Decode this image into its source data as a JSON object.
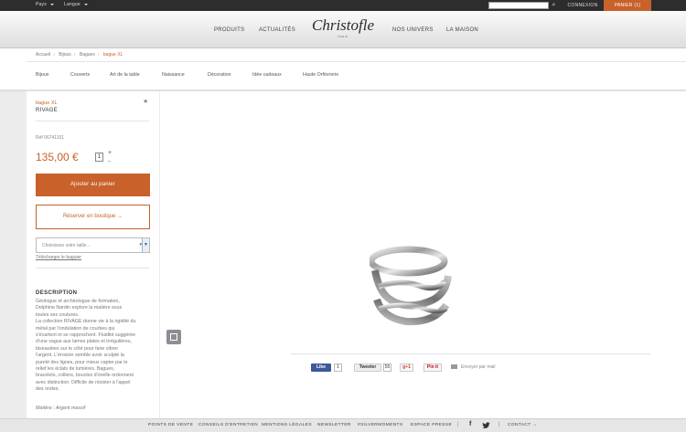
{
  "topbar": {
    "country_label": "Pays",
    "language_label": "Langue",
    "search_placeholder": "",
    "login_label": "CONNEXION",
    "cart_label": "PANIER (1)"
  },
  "header": {
    "nav": [
      "PRODUITS",
      "ACTUALITÉS",
      "NOS UNIVERS",
      "LA MAISON"
    ],
    "logo_text": "Christofle",
    "logo_sub": "PARIS"
  },
  "breadcrumb": [
    "Accueil",
    "Bijoux",
    "Bagues",
    "bague XL"
  ],
  "categories": [
    "Bijoux",
    "Couverts",
    "Art de la table",
    "Naissance",
    "Décoration",
    "Idée cadeaux",
    "Haute Orfèvrerie"
  ],
  "product": {
    "type": "bague XL",
    "name": "RIVAGE",
    "ref": "Réf 06741101",
    "price": "135,00 €",
    "quantity": "1",
    "add_to_cart": "Ajouter au panier",
    "reserve": "Réserver en boutique",
    "size_placeholder": "Choisissez votre taille...",
    "size_guide": "Télécharger le baguier",
    "description_title": "DESCRIPTION",
    "description": "Géologue et archéologue de formation, Delphine Nardin explore la matière sous toutes ses coutures.\nLa collection RIVAGE donne vie à la rigidité du métal par l'ondulation de courbes qui s'écartent et se rapprochent. Fluidité suggérée d'une vague aux lames plates et irrégulières, biseautées sur le côté pour faire vibrer l'argent. L'érosion semble avoir sculpté la pureté des lignes, pour mieux capter par le relief les éclats de lumières. Bagues, bracelets, colliers, boucles d'oreille ordonnent avec distinction. Difficile de résister à l'appel des ondes.",
    "material": "Matière : Argent massif"
  },
  "share": {
    "fb_label": "Like",
    "fb_count": "1",
    "tw_label": "Tweeter",
    "tw_count": "55",
    "gp_label": "g+1",
    "pin_label": "Pin it",
    "mail_label": "Envoyer par mail"
  },
  "footer": {
    "links": [
      "POINTS DE VENTE",
      "CONSEILS D'ENTRETIEN",
      "MENTIONS LÉGALES",
      "NEWSLETTER",
      "#SILVERMOMENTS",
      "ESPACE PRESSE"
    ],
    "contact": "CONTACT"
  },
  "colors": {
    "accent": "#c8612a",
    "dark_bar": "#2d2d2d"
  }
}
